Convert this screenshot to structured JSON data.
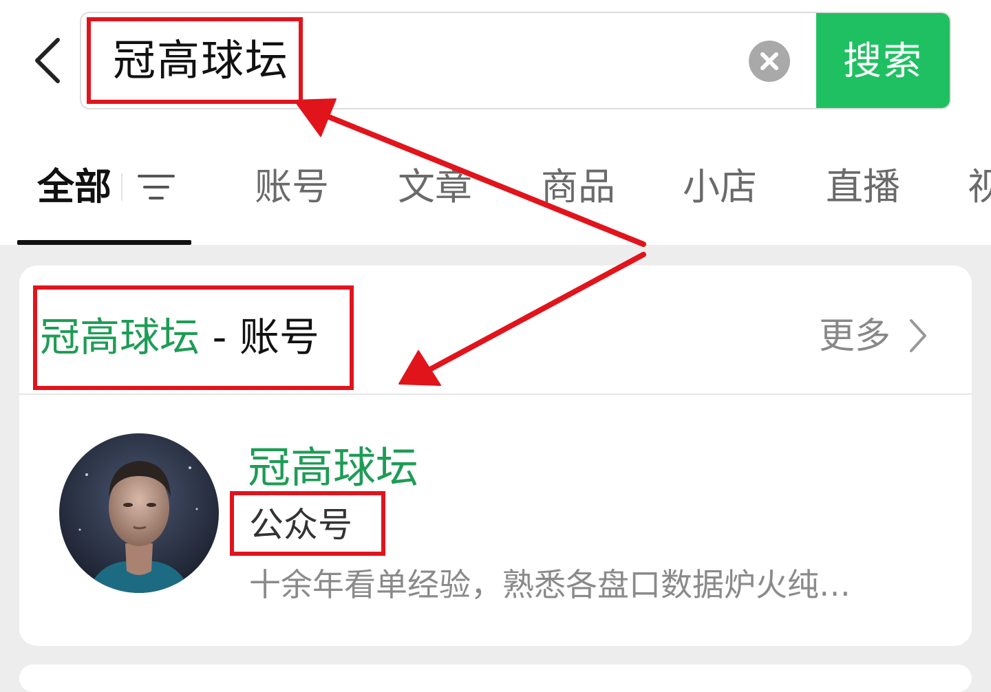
{
  "header": {
    "search_query": "冠高球坛",
    "search_button_label": "搜索",
    "icons": {
      "back": "chevron-left-icon",
      "clear": "clear-x-icon"
    }
  },
  "tabs": [
    {
      "label": "全部",
      "active": true
    },
    {
      "label": "账号",
      "active": false
    },
    {
      "label": "文章",
      "active": false
    },
    {
      "label": "商品",
      "active": false
    },
    {
      "label": "小店",
      "active": false
    },
    {
      "label": "直播",
      "active": false
    },
    {
      "label": "视",
      "active": false
    }
  ],
  "section": {
    "keyword": "冠高球坛",
    "separator": " - ",
    "suffix": "账号",
    "more_label": "更多"
  },
  "account": {
    "name": "冠高球坛",
    "type": "公众号",
    "description": "十余年看单经验，熟悉各盘口数据炉火纯…"
  },
  "colors": {
    "accent_green": "#1fc061",
    "title_green": "#1e9c55",
    "annotation_red": "#e1141c"
  }
}
